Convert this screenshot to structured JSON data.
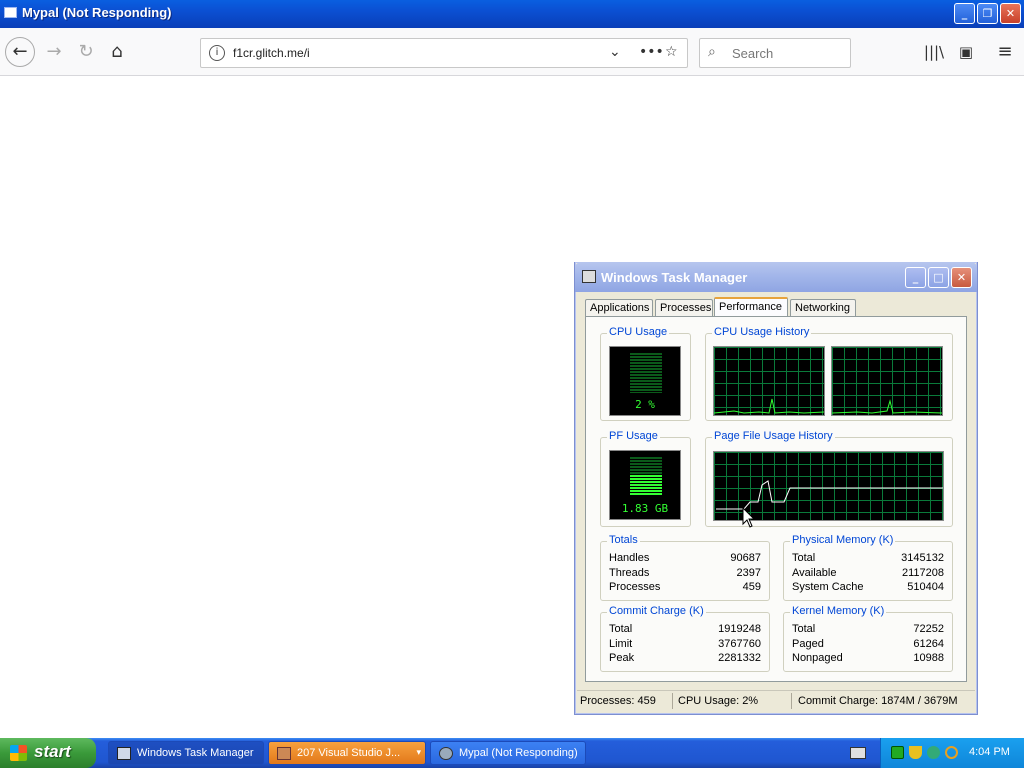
{
  "window": {
    "title": "Mypal (Not Responding)"
  },
  "browser": {
    "url": "f1cr.glitch.me/i",
    "search_placeholder": "Search"
  },
  "taskmanager": {
    "title": "Windows Task Manager",
    "tabs": [
      "Applications",
      "Processes",
      "Performance",
      "Networking"
    ],
    "active_tab": "Performance",
    "cpu_usage": {
      "label": "CPU Usage",
      "value": "2 %",
      "fraction": 0.02
    },
    "cpu_history": {
      "label": "CPU Usage History"
    },
    "pf_usage": {
      "label": "PF Usage",
      "value": "1.83 GB"
    },
    "pf_history": {
      "label": "Page File Usage History"
    },
    "totals": {
      "label": "Totals",
      "rows": [
        {
          "k": "Handles",
          "v": "90687"
        },
        {
          "k": "Threads",
          "v": "2397"
        },
        {
          "k": "Processes",
          "v": "459"
        }
      ]
    },
    "physical": {
      "label": "Physical Memory (K)",
      "rows": [
        {
          "k": "Total",
          "v": "3145132"
        },
        {
          "k": "Available",
          "v": "2117208"
        },
        {
          "k": "System Cache",
          "v": "510404"
        }
      ]
    },
    "commit": {
      "label": "Commit Charge (K)",
      "rows": [
        {
          "k": "Total",
          "v": "1919248"
        },
        {
          "k": "Limit",
          "v": "3767760"
        },
        {
          "k": "Peak",
          "v": "2281332"
        }
      ]
    },
    "kernel": {
      "label": "Kernel Memory (K)",
      "rows": [
        {
          "k": "Total",
          "v": "72252"
        },
        {
          "k": "Paged",
          "v": "61264"
        },
        {
          "k": "Nonpaged",
          "v": "10988"
        }
      ]
    },
    "status": {
      "processes": "Processes: 459",
      "cpu": "CPU Usage: 2%",
      "commit": "Commit Charge: 1874M / 3679M"
    }
  },
  "taskbar": {
    "start": "start",
    "items": [
      {
        "label": "Windows Task Manager"
      },
      {
        "label": "207 Visual Studio J..."
      },
      {
        "label": "Mypal (Not Responding)"
      }
    ],
    "clock": "4:04 PM"
  },
  "colors": {
    "xp_blue": "#245edb",
    "graph_green": "#33ff33",
    "group_label": "#0046d5"
  }
}
